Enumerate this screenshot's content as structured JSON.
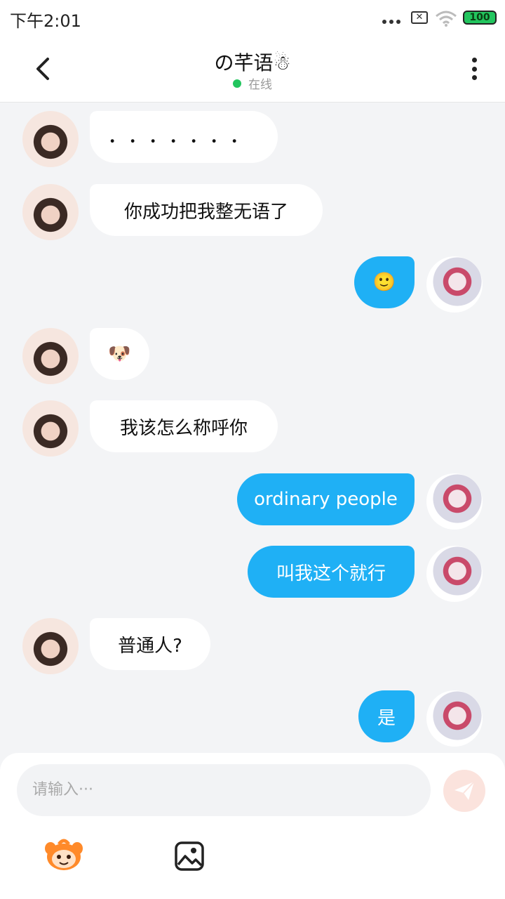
{
  "status_bar": {
    "time": "下午2:01",
    "battery": "100",
    "sim_icon": "x-icon"
  },
  "header": {
    "title": "の芊语☃",
    "status": "在线",
    "status_color": "#22c55e"
  },
  "messages": [
    {
      "side": "left",
      "text": "．．．．．．．"
    },
    {
      "side": "left",
      "text": "你成功把我整无语了"
    },
    {
      "side": "right",
      "text": "🙂"
    },
    {
      "side": "left",
      "text": "🐶"
    },
    {
      "side": "left",
      "text": "我该怎么称呼你"
    },
    {
      "side": "right",
      "text": "ordinary people"
    },
    {
      "side": "right",
      "text": "叫我这个就行"
    },
    {
      "side": "left",
      "text": "普通人?"
    },
    {
      "side": "right",
      "text": "是"
    }
  ],
  "input": {
    "placeholder": "请输入···"
  },
  "colors": {
    "accent_bubble": "#1fb0f5",
    "page_bg": "#f3f4f6"
  }
}
